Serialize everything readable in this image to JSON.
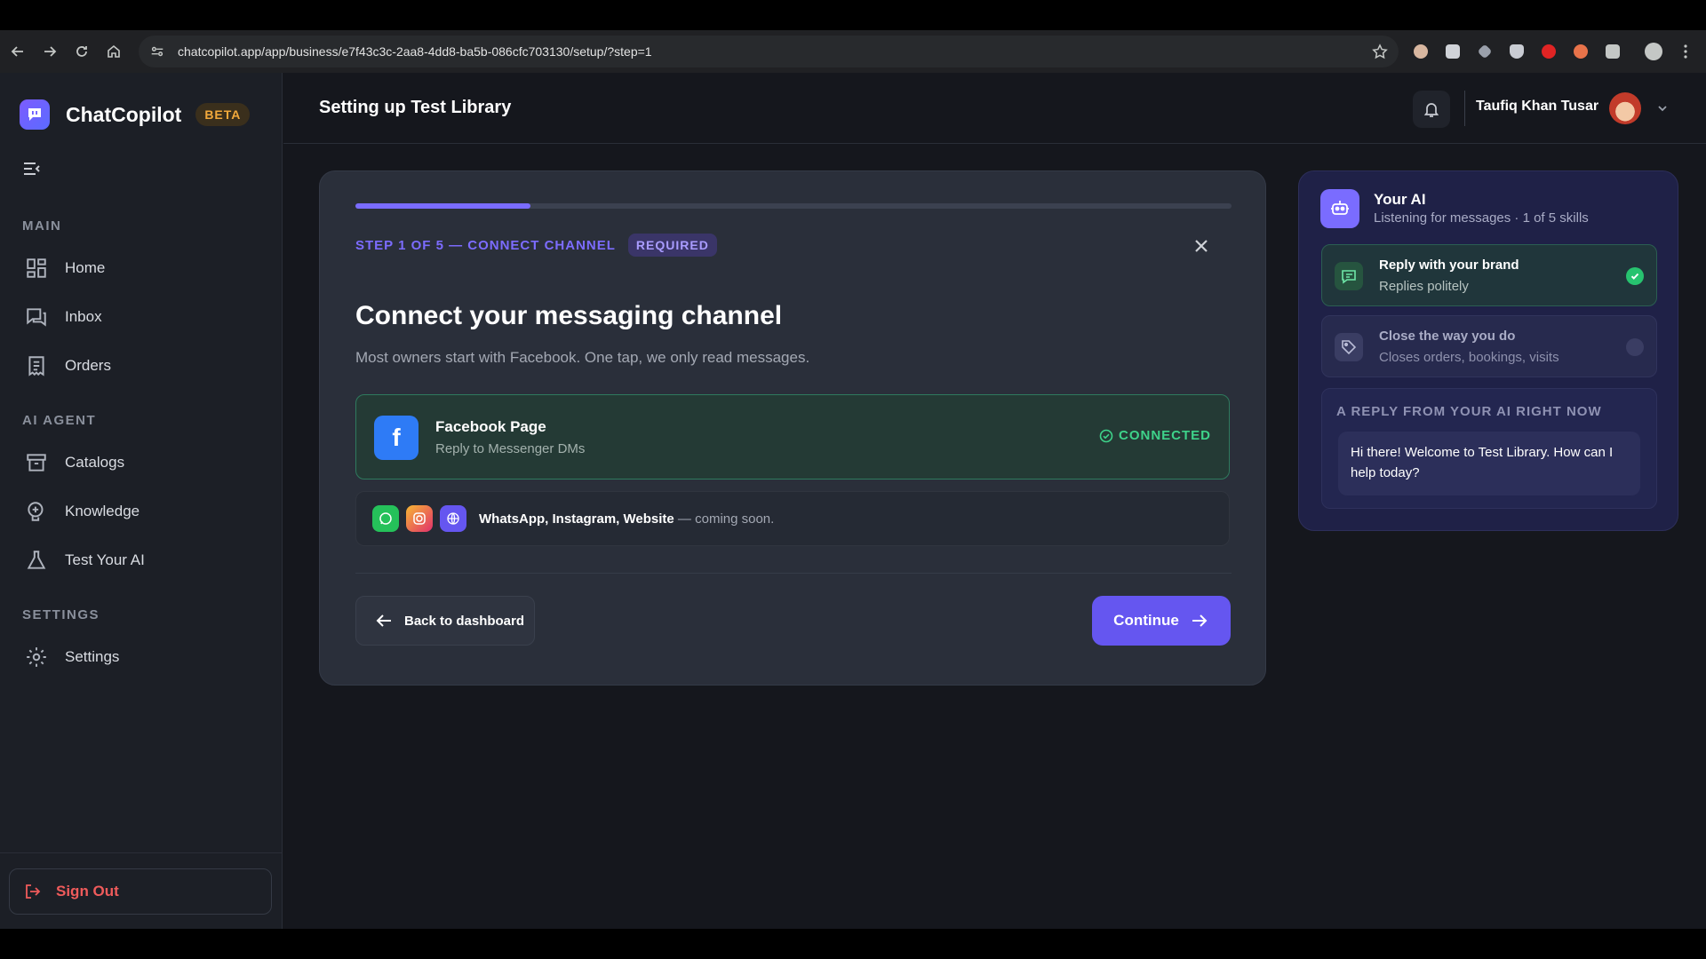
{
  "browser": {
    "url": "chatcopilot.app/app/business/e7f43c3c-2aa8-4dd8-ba5b-086cfc703130/setup/?step=1"
  },
  "brand": {
    "name": "ChatCopilot",
    "badge": "BETA"
  },
  "sidebar": {
    "sections": [
      {
        "label": "MAIN"
      },
      {
        "label": "AI AGENT"
      },
      {
        "label": "SETTINGS"
      }
    ],
    "items": [
      {
        "label": "Home",
        "icon": "grid-icon"
      },
      {
        "label": "Inbox",
        "icon": "chat-icon"
      },
      {
        "label": "Orders",
        "icon": "receipt-icon"
      },
      {
        "label": "Catalogs",
        "icon": "archive-icon"
      },
      {
        "label": "Knowledge",
        "icon": "brain-icon"
      },
      {
        "label": "Test Your AI",
        "icon": "flask-icon"
      },
      {
        "label": "Settings",
        "icon": "gear-icon"
      }
    ],
    "sign_out": "Sign Out"
  },
  "header": {
    "title": "Setting up Test Library",
    "user_name": "Taufiq Khan Tusar"
  },
  "wizard": {
    "progress": 0.2,
    "step_label": "STEP 1 OF 5 — CONNECT CHANNEL",
    "required_badge": "REQUIRED",
    "heading": "Connect your messaging channel",
    "subtext": "Most owners start with Facebook. One tap, we only read messages.",
    "facebook": {
      "title": "Facebook Page",
      "subtitle": "Reply to Messenger DMs",
      "status": "CONNECTED"
    },
    "coming_soon": {
      "channels": "WhatsApp, Instagram, Website",
      "suffix": " — coming soon."
    },
    "back_label": "Back to dashboard",
    "continue_label": "Continue"
  },
  "ai_panel": {
    "title": "Your AI",
    "subtitle": "Listening for messages · 1 of 5 skills",
    "skills": [
      {
        "title": "Reply with your brand",
        "subtitle": "Replies politely",
        "done": true
      },
      {
        "title": "Close the way you do",
        "subtitle": "Closes orders, bookings, visits",
        "done": false
      }
    ],
    "reply_label": "A REPLY FROM YOUR AI RIGHT NOW",
    "reply_text": "Hi there! Welcome to Test Library. How can I help today?"
  },
  "colors": {
    "accent": "#6556f0",
    "success": "#3ed28a",
    "danger": "#ef5b5b",
    "beta": "#f2a93b"
  }
}
